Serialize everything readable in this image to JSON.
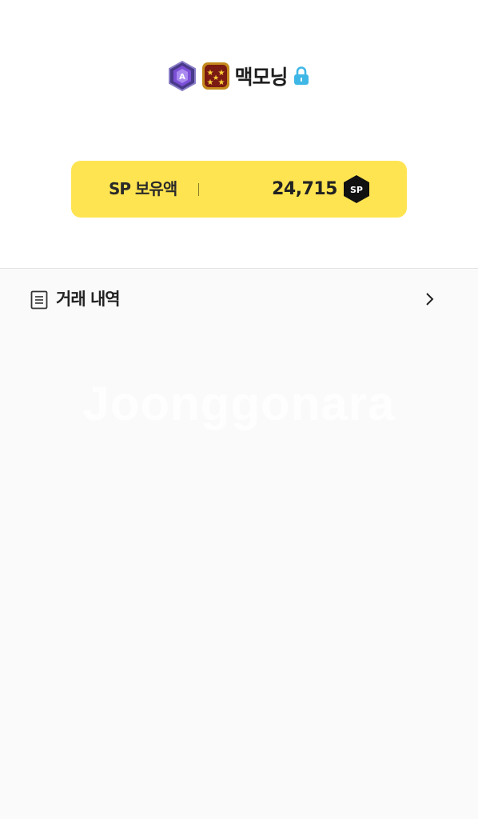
{
  "profile": {
    "nickname": "맥모닝",
    "grade_badge_icon": "purple-hexagon-grade-icon",
    "rank_badge_icon": "five-star-rank-badge-icon",
    "lock_icon": "lock-icon",
    "lock_color": "#3fb7e6"
  },
  "sp_card": {
    "label": "SP 보유액",
    "amount": "24,715",
    "coin_text": "SP",
    "background": "#ffe451"
  },
  "history": {
    "label": "거래 내역"
  },
  "watermark": {
    "text": "Joonggonara"
  }
}
